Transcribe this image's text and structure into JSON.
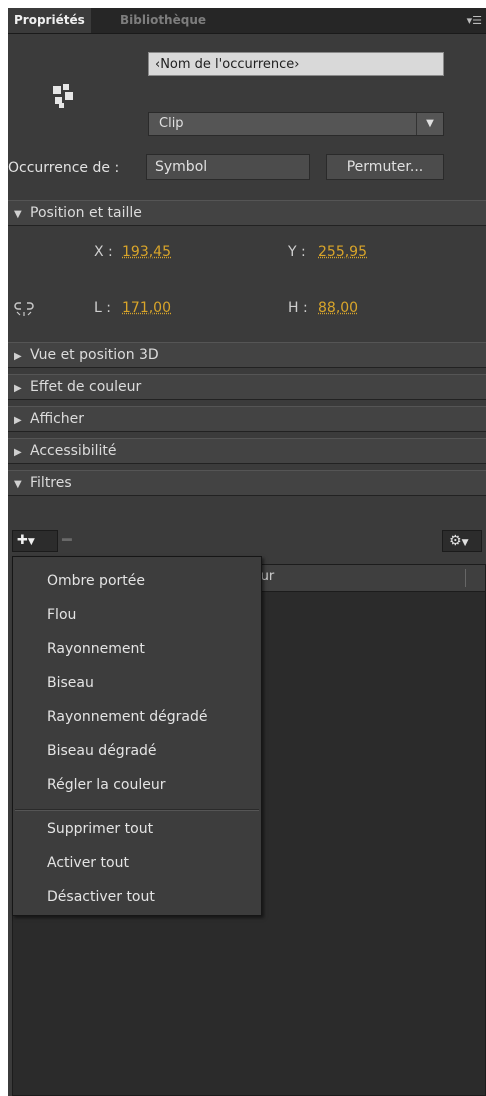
{
  "tabs": {
    "properties": "Propriétés",
    "library": "Bibliothèque"
  },
  "instance_name_placeholder": "‹Nom de l'occurrence›",
  "symbol_type": {
    "selected": "Clip"
  },
  "instance_of": {
    "label": "Occurrence de :",
    "value": "Symbol",
    "swap_button": "Permuter..."
  },
  "sections": {
    "position_size": "Position et taille",
    "view3d": "Vue et position 3D",
    "color_effect": "Effet de couleur",
    "display": "Afficher",
    "accessibility": "Accessibilité",
    "filters": "Filtres"
  },
  "position": {
    "x_label": "X :",
    "x_value": "193,45",
    "y_label": "Y :",
    "y_value": "255,95",
    "w_label": "L :",
    "w_value": "171,00",
    "h_label": "H :",
    "h_value": "88,00"
  },
  "filters_list": {
    "column_header_partial": "leur"
  },
  "filter_menu": {
    "items": [
      "Ombre portée",
      "Flou",
      "Rayonnement",
      "Biseau",
      "Rayonnement dégradé",
      "Biseau dégradé",
      "Régler la couleur"
    ],
    "actions": [
      "Supprimer tout",
      "Activer tout",
      "Désactiver tout"
    ]
  },
  "colors": {
    "panel_bg": "#3b3b3b",
    "value_accent": "#d9a52a"
  }
}
